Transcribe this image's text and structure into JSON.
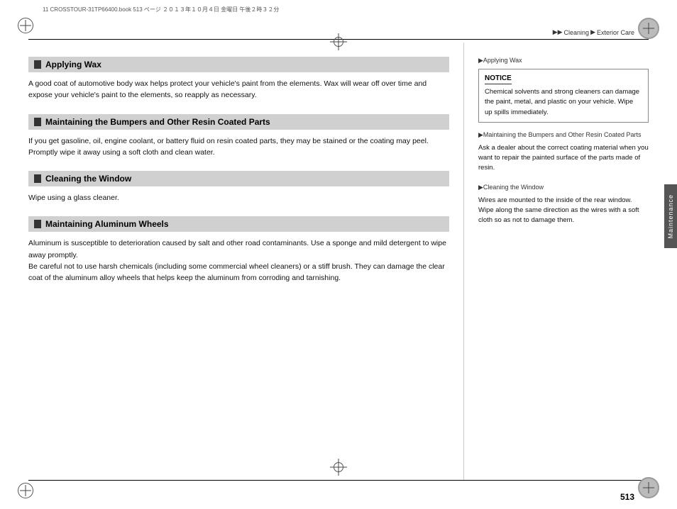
{
  "header": {
    "file_info": "11 CROSSTOUR-31TP66400.book  513 ページ  ２０１３年１０月４日  金曜日  午後２時３２分",
    "breadcrumb": {
      "arrow1": "▶▶",
      "section1": "Cleaning",
      "arrow2": "▶",
      "section2": "Exterior Care"
    }
  },
  "page_number": "513",
  "sidebar_tab": "Maintenance",
  "left_column": {
    "sections": [
      {
        "id": "applying-wax",
        "title": "Applying Wax",
        "body": "A good coat of automotive body wax helps protect your vehicle's paint from the elements. Wax will wear off over time and expose your vehicle's paint to the elements, so reapply as necessary."
      },
      {
        "id": "maintaining-bumpers",
        "title": "Maintaining the Bumpers and Other Resin Coated Parts",
        "body": "If you get gasoline, oil, engine coolant, or battery fluid on resin coated parts, they may be stained or the coating may peel. Promptly wipe it away using a soft cloth and clean water."
      },
      {
        "id": "cleaning-window",
        "title": "Cleaning the Window",
        "body": "Wipe using a glass cleaner."
      },
      {
        "id": "maintaining-aluminum",
        "title": "Maintaining Aluminum Wheels",
        "body": "Aluminum is susceptible to deterioration caused by salt and other road contaminants. Use a sponge and mild detergent to wipe away promptly.\nBe careful not to use harsh chemicals (including some commercial wheel cleaners) or a stiff brush. They can damage the clear coat of the aluminum alloy wheels that helps keep the aluminum from corroding and tarnishing."
      }
    ]
  },
  "right_column": {
    "sections": [
      {
        "id": "applying-wax-ref",
        "label": "▶Applying Wax",
        "notice": {
          "title": "NOTICE",
          "body": "Chemical solvents and strong cleaners can damage the paint, metal, and plastic on your vehicle. Wipe up spills immediately."
        }
      },
      {
        "id": "maintaining-bumpers-ref",
        "label": "▶Maintaining the Bumpers and Other Resin Coated Parts",
        "body": "Ask a dealer about the correct coating material when you want to repair the painted surface of the parts made of resin."
      },
      {
        "id": "cleaning-window-ref",
        "label": "▶Cleaning the Window",
        "body": "Wires are mounted to the inside of the rear window. Wipe along the same direction as the wires with a soft cloth so as not to damage them."
      }
    ]
  }
}
